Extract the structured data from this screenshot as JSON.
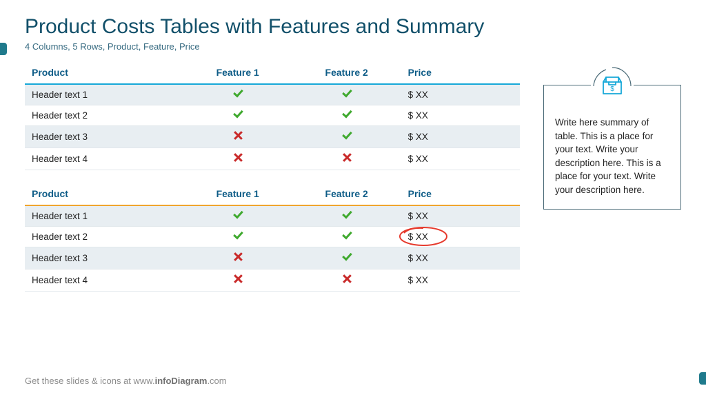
{
  "title": "Product Costs Tables with Features and Summary",
  "subtitle": "4 Columns, 5 Rows, Product, Feature, Price",
  "columns": {
    "product": "Product",
    "feature1": "Feature 1",
    "feature2": "Feature 2",
    "price": "Price"
  },
  "table_a": {
    "rows": [
      {
        "name": "Header text 1",
        "f1": true,
        "f2": true,
        "price": "$ XX"
      },
      {
        "name": "Header text 2",
        "f1": true,
        "f2": true,
        "price": "$ XX"
      },
      {
        "name": "Header text 3",
        "f1": false,
        "f2": true,
        "price": "$ XX"
      },
      {
        "name": "Header text 4",
        "f1": false,
        "f2": false,
        "price": "$ XX"
      }
    ]
  },
  "table_b": {
    "rows": [
      {
        "name": "Header text 1",
        "f1": true,
        "f2": true,
        "price": "$ XX",
        "circled": false
      },
      {
        "name": "Header text 2",
        "f1": true,
        "f2": true,
        "price": "$ XX",
        "circled": true
      },
      {
        "name": "Header text 3",
        "f1": false,
        "f2": true,
        "price": "$ XX",
        "circled": false
      },
      {
        "name": "Header text 4",
        "f1": false,
        "f2": false,
        "price": "$ XX",
        "circled": false
      }
    ]
  },
  "summary": {
    "icon": "box-dollar-icon",
    "text": "Write here summary of table. This is a place for your text. Write your description here. This is a place for your text. Write your description here."
  },
  "footer": {
    "lead": "Get these slides & icons at www.",
    "brand": "infoDiagram",
    "tail": ".com"
  },
  "colors": {
    "heading": "#12506a",
    "accent_a": "#16a8d8",
    "accent_b": "#f0a52e",
    "check": "#3fa92e",
    "cross": "#c92a2a",
    "circle": "#e63a2d"
  }
}
